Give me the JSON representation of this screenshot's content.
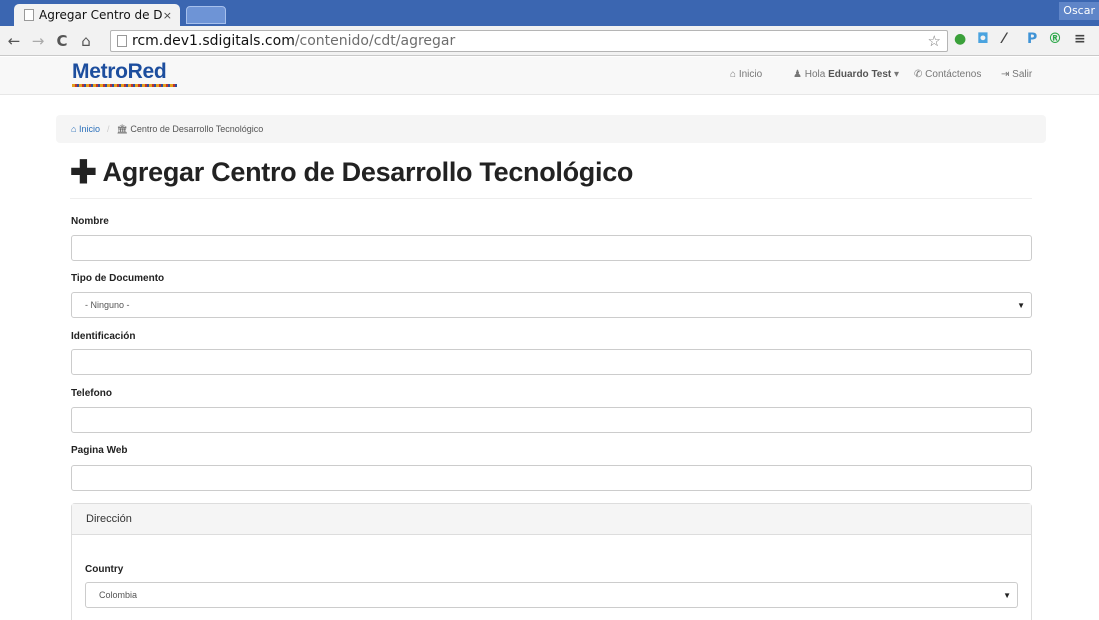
{
  "browser": {
    "tab_title": "Agregar Centro de D",
    "tab_close": "×",
    "profile_name": "Oscar",
    "url_host": "rcm.dev1.sdigitals.com",
    "url_path": "/contenido/cdt/agregar",
    "back": "←",
    "forward": "→",
    "reload": "C",
    "home": "⌂",
    "star": "☆",
    "ext_p": "P",
    "menu": "≡",
    "ext_circle": "®"
  },
  "navbar": {
    "logo": "MetroRed",
    "inicio": "Inicio",
    "greeting": "Hola",
    "user": "Eduardo Test",
    "caret": "▾",
    "contact": "Contáctenos",
    "logout": "Salir"
  },
  "breadcrumb": {
    "home": "Inicio",
    "separator": "/",
    "current": "Centro de Desarrollo Tecnológico"
  },
  "page": {
    "title": "Agregar Centro de Desarrollo Tecnológico",
    "plus": "✚"
  },
  "form": {
    "nombre_label": "Nombre",
    "nombre_value": "",
    "tipo_label": "Tipo de Documento",
    "tipo_value": "- Ninguno -",
    "identificacion_label": "Identificación",
    "identificacion_value": "",
    "telefono_label": "Telefono",
    "telefono_value": "",
    "web_label": "Pagina Web",
    "web_value": "",
    "direccion_heading": "Dirección",
    "country_label": "Country",
    "country_value": "Colombia",
    "select_caret": "▼"
  },
  "colors": {
    "tab_strip": "#3b66b1",
    "link_blue": "#2a6fba",
    "logo_blue": "#1d4e9e"
  }
}
